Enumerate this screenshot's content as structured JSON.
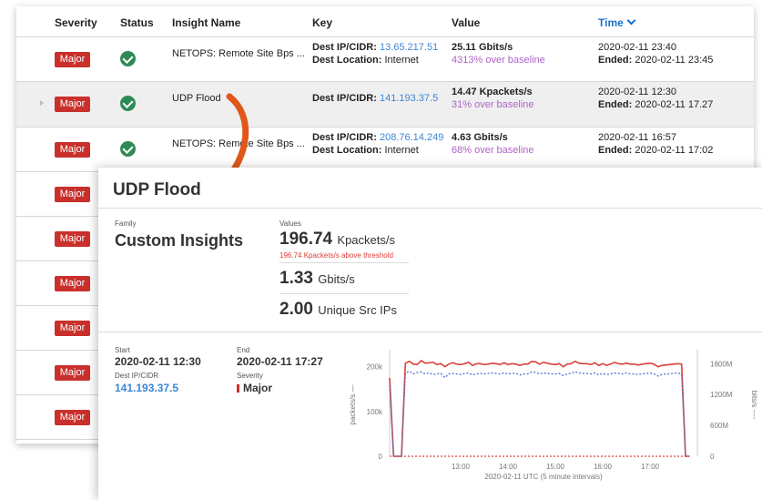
{
  "table": {
    "headers": {
      "severity": "Severity",
      "status": "Status",
      "insight": "Insight Name",
      "key": "Key",
      "value": "Value",
      "time": "Time"
    },
    "rows": [
      {
        "severity": "Major",
        "insight": "NETOPS: Remote Site Bps ...",
        "key_label": "Dest IP/CIDR:",
        "key_value": "13.65.217.51",
        "loc_label": "Dest Location:",
        "loc_value": "Internet",
        "value": "25.11 Gbits/s",
        "baseline_pct": "4313%",
        "baseline_text": "over baseline",
        "time": "2020-02-11  23:40",
        "ended_label": "Ended:",
        "ended": "2020-02-11  23:45"
      },
      {
        "severity": "Major",
        "insight": "UDP Flood",
        "key_label": "Dest IP/CIDR:",
        "key_value": "141.193.37.5",
        "loc_label": "",
        "loc_value": "",
        "value": "14.47 Kpackets/s",
        "baseline_pct": "31%",
        "baseline_text": "over baseline",
        "time": "2020-02-11 12:30",
        "ended_label": "Ended:",
        "ended": "2020-02-11 17.27"
      },
      {
        "severity": "Major",
        "insight": "NETOPS: Remote Site Bps ...",
        "key_label": "Dest IP/CIDR:",
        "key_value": "208.76.14.249",
        "loc_label": "Dest Location:",
        "loc_value": "Internet",
        "value": "4.63 Gbits/s",
        "baseline_pct": "68%",
        "baseline_text": "over baseline",
        "time": "2020-02-11  16:57",
        "ended_label": "Ended:",
        "ended": "2020-02-11  17:02"
      },
      {
        "severity": "Major"
      },
      {
        "severity": "Major"
      },
      {
        "severity": "Major"
      },
      {
        "severity": "Major"
      },
      {
        "severity": "Major"
      },
      {
        "severity": "Major"
      }
    ]
  },
  "detail": {
    "title": "UDP Flood",
    "family_label": "Family",
    "family_value": "Custom Insights",
    "values_label": "Values",
    "metric1_value": "196.74",
    "metric1_unit": "Kpackets/s",
    "metric1_note": "196.74 Kpackets/s above threshold",
    "metric2_value": "1.33",
    "metric2_unit": "Gbits/s",
    "metric3_value": "2.00",
    "metric3_unit": "Unique Src IPs",
    "start_label": "Start",
    "start_value": "2020-02-11 12:30",
    "end_label": "End",
    "end_value": "2020-02-11 17:27",
    "dest_label": "Dest IP/CIDR",
    "dest_value": "141.193.37.5",
    "severity_label": "Severity",
    "severity_value": "Major"
  },
  "colors": {
    "major_red": "#c9302c",
    "link_blue": "#3b86d6",
    "baseline_purple": "#b064c9",
    "arrow_orange": "#e0561b",
    "status_green": "#2e8b57"
  },
  "chart_data": {
    "type": "line",
    "xlabel": "2020-02-11 UTC (5 minute intervals)",
    "ylabel_left": "packets/s —",
    "ylabel_right": "bits/s ----",
    "x_ticks": [
      "13:00",
      "14:00",
      "15:00",
      "16:00",
      "17:00"
    ],
    "y_left_ticks": [
      "0",
      "100k",
      "200k"
    ],
    "y_right_ticks": [
      "0",
      "600M",
      "1200M",
      "1800M"
    ],
    "ylim_left": [
      0,
      230000
    ],
    "ylim_right": [
      0,
      2000000000
    ],
    "x_minutes_from": 690,
    "x_minutes_to": 1080,
    "series": [
      {
        "name": "packets/s",
        "color": "#d9413a",
        "dashed": false,
        "axis": "left",
        "x": [
          690,
          695,
          700,
          705,
          710,
          715,
          720,
          725,
          730,
          735,
          740,
          745,
          750,
          755,
          760,
          765,
          770,
          775,
          780,
          785,
          790,
          795,
          800,
          805,
          810,
          815,
          820,
          825,
          830,
          835,
          840,
          845,
          850,
          855,
          860,
          865,
          870,
          875,
          880,
          885,
          890,
          895,
          900,
          905,
          910,
          915,
          920,
          925,
          930,
          935,
          940,
          945,
          950,
          955,
          960,
          965,
          970,
          975,
          980,
          985,
          990,
          995,
          1000,
          1005,
          1010,
          1015,
          1020,
          1025,
          1030,
          1035,
          1040,
          1045,
          1050,
          1055,
          1060,
          1065,
          1070
        ],
        "values": [
          175000,
          0,
          0,
          0,
          208000,
          212000,
          206000,
          205000,
          214000,
          208000,
          209000,
          210000,
          205000,
          207000,
          200000,
          206000,
          209000,
          206000,
          205000,
          207000,
          210000,
          203000,
          207000,
          207000,
          205000,
          206000,
          208000,
          207000,
          205000,
          209000,
          205000,
          207000,
          206000,
          203000,
          206000,
          206000,
          212000,
          211000,
          206000,
          210000,
          208000,
          206000,
          205000,
          207000,
          200000,
          206000,
          207000,
          212000,
          208000,
          207000,
          207000,
          205000,
          209000,
          203000,
          207000,
          203000,
          206000,
          210000,
          207000,
          206000,
          208000,
          206000,
          206000,
          204000,
          206000,
          207000,
          208000,
          206000,
          200000,
          203000,
          204000,
          205000,
          206000,
          207000,
          206000,
          0,
          0
        ]
      },
      {
        "name": "bits/s",
        "color": "#4a72c9",
        "dashed": true,
        "axis": "right",
        "x": [
          690,
          695,
          700,
          705,
          710,
          715,
          720,
          725,
          730,
          735,
          740,
          745,
          750,
          755,
          760,
          765,
          770,
          775,
          780,
          785,
          790,
          795,
          800,
          805,
          810,
          815,
          820,
          825,
          830,
          835,
          840,
          845,
          850,
          855,
          860,
          865,
          870,
          875,
          880,
          885,
          890,
          895,
          900,
          905,
          910,
          915,
          920,
          925,
          930,
          935,
          940,
          945,
          950,
          955,
          960,
          965,
          970,
          975,
          980,
          985,
          990,
          995,
          1000,
          1005,
          1010,
          1015,
          1020,
          1025,
          1030,
          1035,
          1040,
          1045,
          1050,
          1055,
          1060,
          1065,
          1070
        ],
        "values": [
          1380000000,
          0,
          0,
          0,
          1620000000,
          1650000000,
          1600000000,
          1630000000,
          1640000000,
          1600000000,
          1620000000,
          1590000000,
          1600000000,
          1610000000,
          1530000000,
          1600000000,
          1610000000,
          1600000000,
          1590000000,
          1610000000,
          1620000000,
          1580000000,
          1600000000,
          1610000000,
          1600000000,
          1610000000,
          1620000000,
          1610000000,
          1600000000,
          1620000000,
          1600000000,
          1610000000,
          1610000000,
          1580000000,
          1600000000,
          1600000000,
          1640000000,
          1630000000,
          1600000000,
          1620000000,
          1610000000,
          1600000000,
          1600000000,
          1610000000,
          1570000000,
          1600000000,
          1610000000,
          1640000000,
          1620000000,
          1610000000,
          1610000000,
          1600000000,
          1620000000,
          1580000000,
          1610000000,
          1590000000,
          1600000000,
          1620000000,
          1610000000,
          1600000000,
          1620000000,
          1600000000,
          1600000000,
          1590000000,
          1600000000,
          1610000000,
          1620000000,
          1600000000,
          1560000000,
          1590000000,
          1600000000,
          1600000000,
          1610000000,
          1620000000,
          1600000000,
          0,
          0
        ]
      },
      {
        "name": "threshold",
        "color": "#d9413a",
        "dashed": true,
        "axis": "left",
        "x": [
          690,
          1070
        ],
        "values": [
          0,
          0
        ]
      }
    ]
  }
}
